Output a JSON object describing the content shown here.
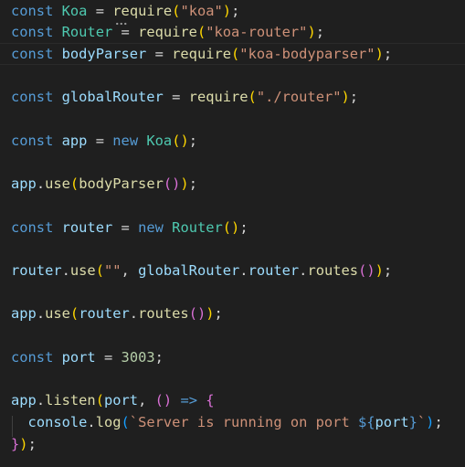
{
  "colors": {
    "background": "#1f1f1f",
    "keyword": "#569cd6",
    "variable": "#9cdcfe",
    "class": "#4ec9b0",
    "function": "#dcdcaa",
    "string": "#ce9178",
    "number": "#b5cea8",
    "operator": "#d4d4d4",
    "bracket_level_1": "#ffd700",
    "bracket_level_2": "#da70d6",
    "bracket_level_3": "#179fff"
  },
  "editor": {
    "lines": [
      [
        [
          "kw",
          "const"
        ],
        [
          "ws",
          " "
        ],
        [
          "cls",
          "Koa"
        ],
        [
          "ws",
          " "
        ],
        [
          "op",
          "="
        ],
        [
          "ws",
          " "
        ],
        [
          "fn",
          "require"
        ],
        [
          "p1",
          "("
        ],
        [
          "str",
          "\"koa\""
        ],
        [
          "p1",
          ")"
        ],
        [
          "op",
          ";"
        ]
      ],
      [
        [
          "kw",
          "const"
        ],
        [
          "ws",
          " "
        ],
        [
          "cls",
          "Router"
        ],
        [
          "ws",
          " "
        ],
        [
          "op",
          "="
        ],
        [
          "ws",
          " "
        ],
        [
          "fn",
          "require"
        ],
        [
          "p1",
          "("
        ],
        [
          "str",
          "\"koa-router\""
        ],
        [
          "p1",
          ")"
        ],
        [
          "op",
          ";"
        ]
      ],
      [
        [
          "kw",
          "const"
        ],
        [
          "ws",
          " "
        ],
        [
          "var",
          "bodyParser"
        ],
        [
          "ws",
          " "
        ],
        [
          "op",
          "="
        ],
        [
          "ws",
          " "
        ],
        [
          "fn",
          "require"
        ],
        [
          "p1",
          "("
        ],
        [
          "str",
          "\"koa-bodyparser\""
        ],
        [
          "p1",
          ")"
        ],
        [
          "op",
          ";"
        ]
      ],
      [],
      [
        [
          "kw",
          "const"
        ],
        [
          "ws",
          " "
        ],
        [
          "var",
          "globalRouter"
        ],
        [
          "ws",
          " "
        ],
        [
          "op",
          "="
        ],
        [
          "ws",
          " "
        ],
        [
          "fn",
          "require"
        ],
        [
          "p1",
          "("
        ],
        [
          "str",
          "\"./router\""
        ],
        [
          "p1",
          ")"
        ],
        [
          "op",
          ";"
        ]
      ],
      [],
      [
        [
          "kw",
          "const"
        ],
        [
          "ws",
          " "
        ],
        [
          "var",
          "app"
        ],
        [
          "ws",
          " "
        ],
        [
          "op",
          "="
        ],
        [
          "ws",
          " "
        ],
        [
          "kw",
          "new"
        ],
        [
          "ws",
          " "
        ],
        [
          "cls",
          "Koa"
        ],
        [
          "p1",
          "()"
        ],
        [
          "op",
          ";"
        ]
      ],
      [],
      [
        [
          "var",
          "app"
        ],
        [
          "op",
          "."
        ],
        [
          "fn",
          "use"
        ],
        [
          "p1",
          "("
        ],
        [
          "fn",
          "bodyParser"
        ],
        [
          "p2",
          "()"
        ],
        [
          "p1",
          ")"
        ],
        [
          "op",
          ";"
        ]
      ],
      [],
      [
        [
          "kw",
          "const"
        ],
        [
          "ws",
          " "
        ],
        [
          "var",
          "router"
        ],
        [
          "ws",
          " "
        ],
        [
          "op",
          "="
        ],
        [
          "ws",
          " "
        ],
        [
          "kw",
          "new"
        ],
        [
          "ws",
          " "
        ],
        [
          "cls",
          "Router"
        ],
        [
          "p1",
          "()"
        ],
        [
          "op",
          ";"
        ]
      ],
      [],
      [
        [
          "var",
          "router"
        ],
        [
          "op",
          "."
        ],
        [
          "fn",
          "use"
        ],
        [
          "p1",
          "("
        ],
        [
          "str",
          "\"\""
        ],
        [
          "op",
          ", "
        ],
        [
          "var",
          "globalRouter"
        ],
        [
          "op",
          "."
        ],
        [
          "var",
          "router"
        ],
        [
          "op",
          "."
        ],
        [
          "fn",
          "routes"
        ],
        [
          "p2",
          "()"
        ],
        [
          "p1",
          ")"
        ],
        [
          "op",
          ";"
        ]
      ],
      [],
      [
        [
          "var",
          "app"
        ],
        [
          "op",
          "."
        ],
        [
          "fn",
          "use"
        ],
        [
          "p1",
          "("
        ],
        [
          "var",
          "router"
        ],
        [
          "op",
          "."
        ],
        [
          "fn",
          "routes"
        ],
        [
          "p2",
          "()"
        ],
        [
          "p1",
          ")"
        ],
        [
          "op",
          ";"
        ]
      ],
      [],
      [
        [
          "kw",
          "const"
        ],
        [
          "ws",
          " "
        ],
        [
          "var",
          "port"
        ],
        [
          "ws",
          " "
        ],
        [
          "op",
          "="
        ],
        [
          "ws",
          " "
        ],
        [
          "num",
          "3003"
        ],
        [
          "op",
          ";"
        ]
      ],
      [],
      [
        [
          "var",
          "app"
        ],
        [
          "op",
          "."
        ],
        [
          "fn",
          "listen"
        ],
        [
          "p1",
          "("
        ],
        [
          "var",
          "port"
        ],
        [
          "op",
          ", "
        ],
        [
          "p2",
          "()"
        ],
        [
          "ws",
          " "
        ],
        [
          "kw",
          "=>"
        ],
        [
          "ws",
          " "
        ],
        [
          "p2",
          "{"
        ]
      ],
      [
        [
          "ws",
          "  "
        ],
        [
          "var",
          "console"
        ],
        [
          "op",
          "."
        ],
        [
          "fn",
          "log"
        ],
        [
          "p3",
          "("
        ],
        [
          "str",
          "`Server is running on port "
        ],
        [
          "kw",
          "${"
        ],
        [
          "var",
          "port"
        ],
        [
          "kw",
          "}"
        ],
        [
          "str",
          "`"
        ],
        [
          "p3",
          ")"
        ],
        [
          "op",
          ";"
        ]
      ],
      [
        [
          "p2",
          "}"
        ],
        [
          "p1",
          ")"
        ],
        [
          "op",
          ";"
        ]
      ]
    ]
  }
}
